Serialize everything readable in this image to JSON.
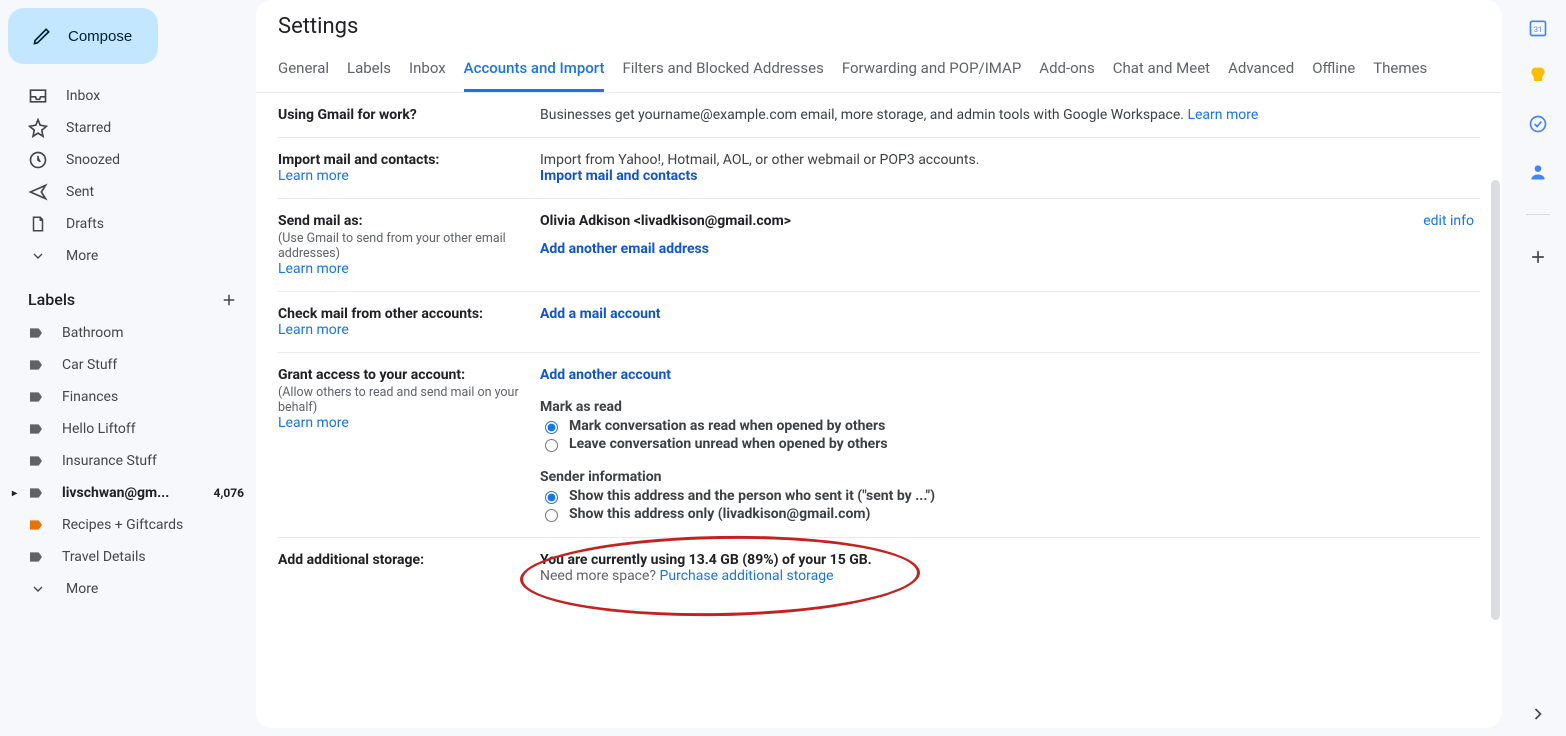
{
  "sidebar": {
    "compose": "Compose",
    "nav": [
      {
        "icon": "inbox",
        "label": "Inbox"
      },
      {
        "icon": "star",
        "label": "Starred"
      },
      {
        "icon": "clock",
        "label": "Snoozed"
      },
      {
        "icon": "send",
        "label": "Sent"
      },
      {
        "icon": "file",
        "label": "Drafts"
      },
      {
        "icon": "chevron",
        "label": "More"
      }
    ],
    "labels_header": "Labels",
    "labels": [
      {
        "name": "Bathroom",
        "color": "#5f6368"
      },
      {
        "name": "Car Stuff",
        "color": "#5f6368"
      },
      {
        "name": "Finances",
        "color": "#5f6368"
      },
      {
        "name": "Hello Liftoff",
        "color": "#5f6368"
      },
      {
        "name": "Insurance Stuff",
        "color": "#5f6368"
      },
      {
        "name": "livschwan@gm...",
        "color": "#5f6368",
        "count": "4,076",
        "bold": true,
        "caret": true
      },
      {
        "name": "Recipes + Giftcards",
        "color": "#e8710a"
      },
      {
        "name": "Travel Details",
        "color": "#5f6368"
      }
    ],
    "more": "More"
  },
  "settings": {
    "title": "Settings",
    "tabs": [
      "General",
      "Labels",
      "Inbox",
      "Accounts and Import",
      "Filters and Blocked Addresses",
      "Forwarding and POP/IMAP",
      "Add-ons",
      "Chat and Meet",
      "Advanced",
      "Offline",
      "Themes"
    ],
    "active_tab": 3,
    "sections": {
      "work": {
        "title": "Using Gmail for work?",
        "body": "Businesses get yourname@example.com email, more storage, and admin tools with Google Workspace.",
        "learn": "Learn more"
      },
      "import": {
        "title": "Import mail and contacts:",
        "learn": "Learn more",
        "body": "Import from Yahoo!, Hotmail, AOL, or other webmail or POP3 accounts.",
        "action": "Import mail and contacts"
      },
      "sendas": {
        "title": "Send mail as:",
        "subtitle": "(Use Gmail to send from your other email addresses)",
        "learn": "Learn more",
        "identity": "Olivia Adkison <livadkison@gmail.com>",
        "add": "Add another email address",
        "edit": "edit info"
      },
      "check": {
        "title": "Check mail from other accounts:",
        "learn": "Learn more",
        "add": "Add a mail account"
      },
      "grant": {
        "title": "Grant access to your account:",
        "subtitle": "(Allow others to read and send mail on your behalf)",
        "learn": "Learn more",
        "add": "Add another account",
        "mark_title": "Mark as read",
        "mark_opt1": "Mark conversation as read when opened by others",
        "mark_opt2": "Leave conversation unread when opened by others",
        "sender_title": "Sender information",
        "sender_opt1": "Show this address and the person who sent it (\"sent by ...\")",
        "sender_opt2": "Show this address only (livadkison@gmail.com)"
      },
      "storage": {
        "title": "Add additional storage:",
        "body": "You are currently using 13.4 GB (89%) of your 15 GB.",
        "need": "Need more space? ",
        "purchase": "Purchase additional storage"
      }
    }
  },
  "rail": {
    "icons": [
      "calendar",
      "keep",
      "tasks",
      "contacts"
    ],
    "plus": "+"
  }
}
